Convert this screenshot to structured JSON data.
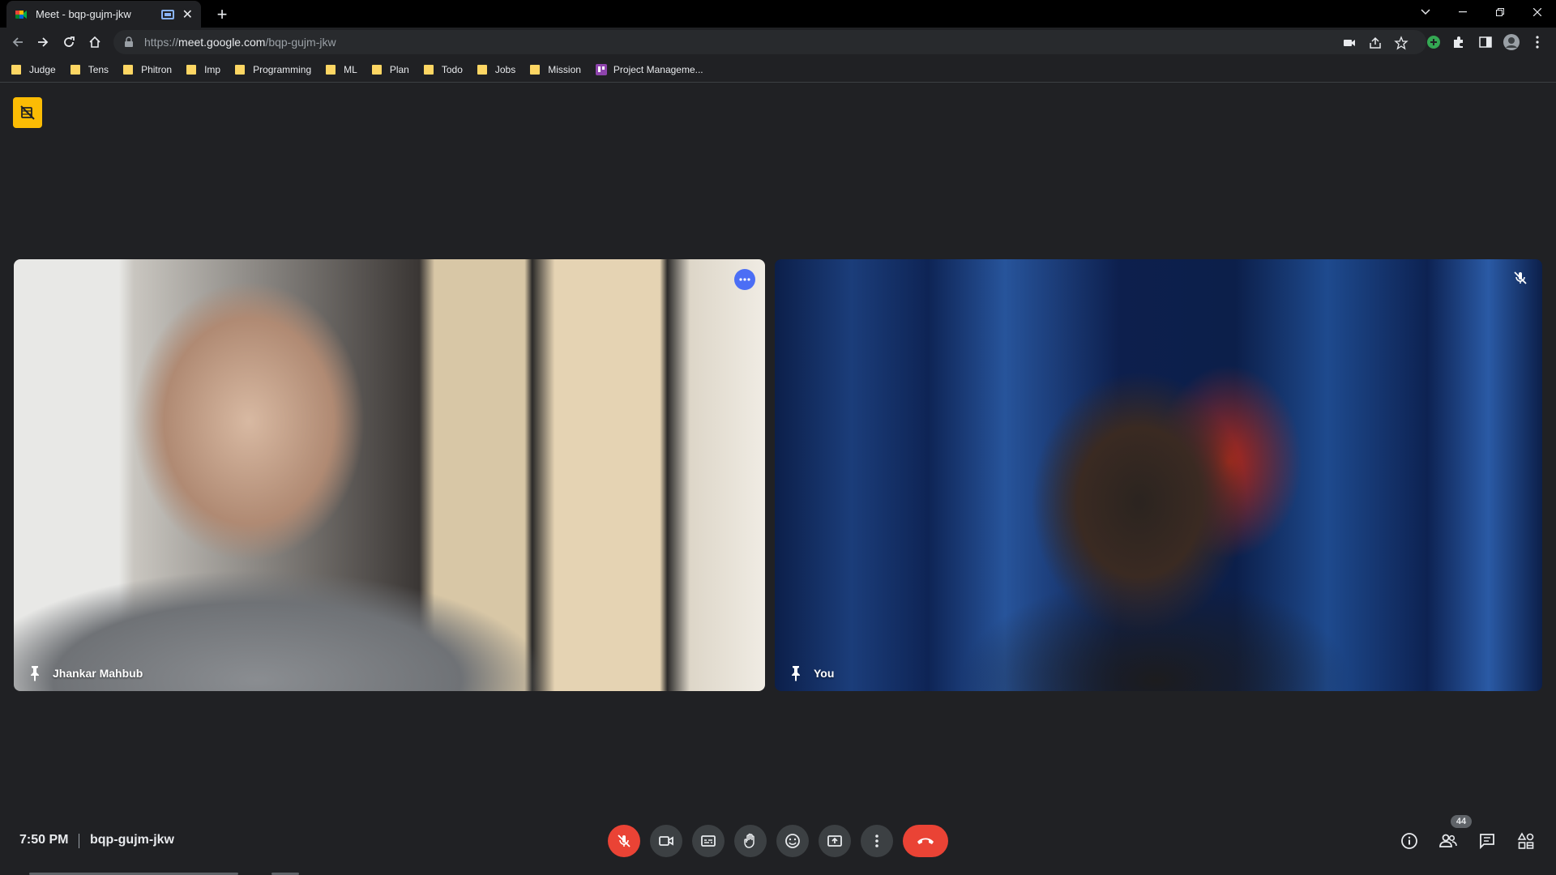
{
  "browser": {
    "tab_title": "Meet - bqp-gujm-jkw",
    "close_label": "✕",
    "new_tab_label": "+",
    "url_prefix": "https://",
    "url_host": "meet.google.com",
    "url_path": "/bqp-gujm-jkw"
  },
  "bookmarks": [
    "Judge",
    "Tens",
    "Phitron",
    "Imp",
    "Programming",
    "ML",
    "Plan",
    "Todo",
    "Jobs",
    "Mission"
  ],
  "bookmark_trello": "Project Manageme...",
  "tiles": {
    "left_name": "Jhankar Mahbub",
    "right_name": "You"
  },
  "footer": {
    "time": "7:50 PM",
    "meeting_code": "bqp-gujm-jkw",
    "people_count": "44"
  },
  "colors": {
    "accent": "#8ab4f8",
    "danger": "#ea4335",
    "badge": "#fbbc04",
    "more_button": "#4b6ef5"
  },
  "icons": [
    "meet-icon",
    "camera-off-icon",
    "mic-off-icon",
    "videocam-icon",
    "captions-icon",
    "raise-hand-icon",
    "emoji-icon",
    "present-icon",
    "more-vert-icon",
    "call-end-icon",
    "info-icon",
    "people-icon",
    "chat-icon",
    "activities-icon",
    "pin-icon"
  ]
}
